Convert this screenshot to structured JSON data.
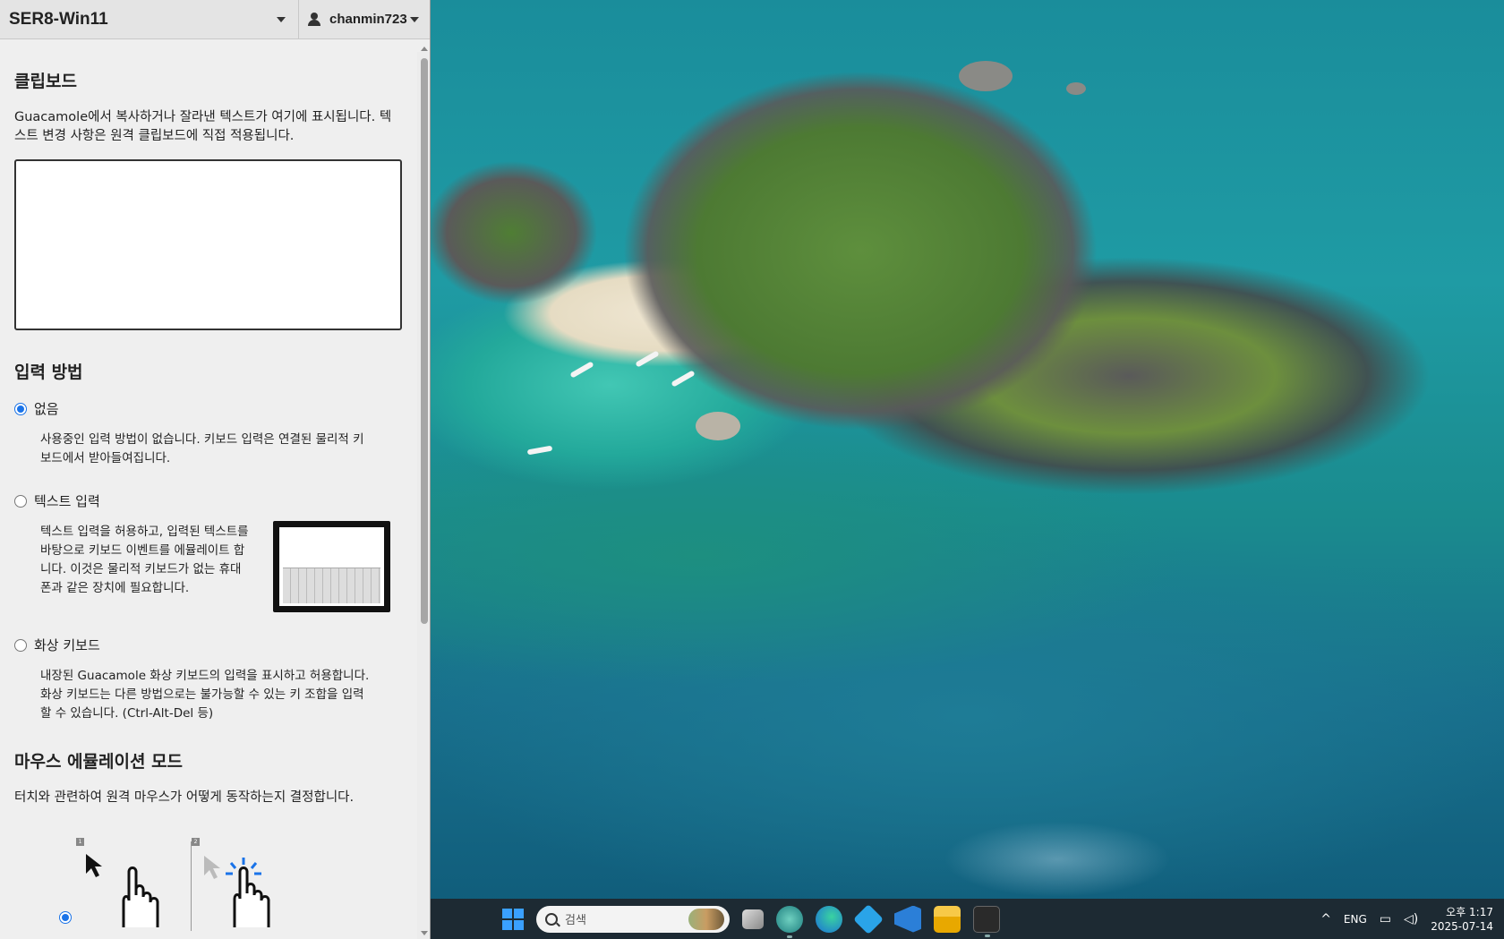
{
  "header": {
    "connection_name": "SER8-Win11",
    "username": "chanmin723"
  },
  "clipboard": {
    "title": "클립보드",
    "description": "Guacamole에서 복사하거나 잘라낸 텍스트가 여기에 표시됩니다. 텍스트 변경 사항은 원격 클립보드에 직접 적용됩니다.",
    "value": ""
  },
  "input_method": {
    "title": "입력 방법",
    "options": [
      {
        "label": "없음",
        "selected": true,
        "description": "사용중인 입력 방법이 없습니다. 키보드 입력은 연결된 물리적 키보드에서 받아들여집니다."
      },
      {
        "label": "텍스트 입력",
        "selected": false,
        "description": "텍스트 입력을 허용하고, 입력된 텍스트를 바탕으로 키보드 이벤트를 에뮬레이트 합니다. 이것은 물리적 키보드가 없는 휴대폰과 같은 장치에 필요합니다."
      },
      {
        "label": "화상 키보드",
        "selected": false,
        "description": "내장된 Guacamole 화상 키보드의 입력을 표시하고 허용합니다. 화상 키보드는 다른 방법으로는 불가능할 수 있는 키 조합을 입력할 수 있습니다. (Ctrl-Alt-Del 등)"
      }
    ]
  },
  "mouse_mode": {
    "title": "마우스 에뮬레이션 모드",
    "description": "터치와 관련하여 원격 마우스가 어떻게 동작하는지 결정합니다.",
    "badges": [
      "1",
      "2"
    ]
  },
  "taskbar": {
    "search_placeholder": "검색",
    "language": "ENG",
    "time": "오후 1:17",
    "date": "2025-07-14"
  }
}
